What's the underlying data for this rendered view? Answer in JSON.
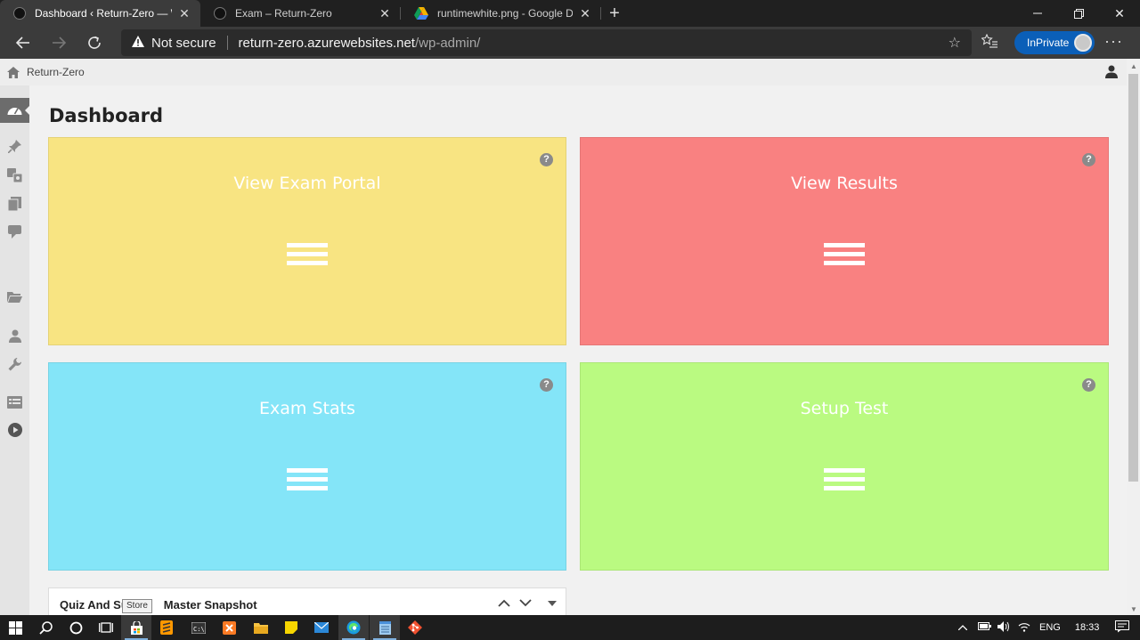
{
  "browser": {
    "tabs": [
      {
        "title": "Dashboard ‹ Return-Zero — Wor",
        "active": true
      },
      {
        "title": "Exam – Return-Zero",
        "active": false
      },
      {
        "title": "runtimewhite.png - Google Drive",
        "active": false
      }
    ],
    "security_label": "Not secure",
    "url_host": "return-zero.azurewebsites.net",
    "url_path": "/wp-admin/",
    "inprivate_label": "InPrivate"
  },
  "admin_bar": {
    "site_name": "Return-Zero"
  },
  "page": {
    "title": "Dashboard"
  },
  "cards": [
    {
      "title": "View Exam Portal",
      "color": "#f8e482"
    },
    {
      "title": "View Results",
      "color": "#f98181"
    },
    {
      "title": "Exam Stats",
      "color": "#84e5f8"
    },
    {
      "title": "Setup Test",
      "color": "#bafa81"
    }
  ],
  "widget": {
    "title_start": "Quiz And Su",
    "title_end": "Master Snapshot"
  },
  "tooltip": "Store",
  "taskbar": {
    "language": "ENG",
    "time": "18:33"
  }
}
